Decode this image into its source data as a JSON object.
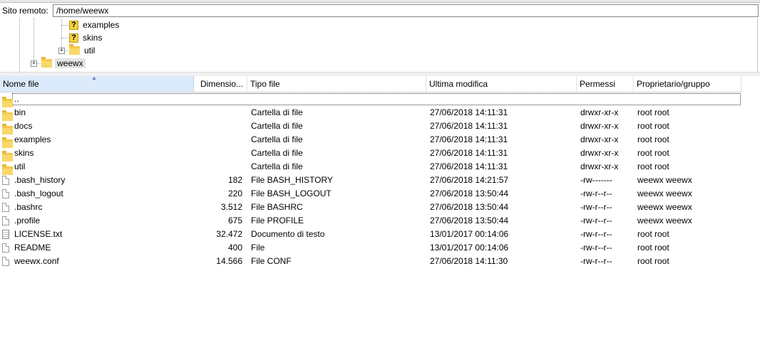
{
  "path_bar": {
    "label": "Sito remoto:",
    "value": "/home/weewx"
  },
  "tree": [
    {
      "label": "examples",
      "icon": "question-folder-icon"
    },
    {
      "label": "skins",
      "icon": "question-folder-icon"
    },
    {
      "label": "util",
      "icon": "folder-icon",
      "expander": "+"
    },
    {
      "label": "weewx",
      "icon": "folder-icon",
      "expander": "+"
    }
  ],
  "columns": [
    "Nome file",
    "Dimensio...",
    "Tipo file",
    "Ultima modifica",
    "Permessi",
    "Proprietario/gruppo"
  ],
  "files": [
    {
      "name": "..",
      "size": "",
      "type": "",
      "modified": "",
      "perms": "",
      "owner": "",
      "icon": "folder-icon"
    },
    {
      "name": "bin",
      "size": "",
      "type": "Cartella di file",
      "modified": "27/06/2018 14:11:31",
      "perms": "drwxr-xr-x",
      "owner": "root root",
      "icon": "folder-icon"
    },
    {
      "name": "docs",
      "size": "",
      "type": "Cartella di file",
      "modified": "27/06/2018 14:11:31",
      "perms": "drwxr-xr-x",
      "owner": "root root",
      "icon": "folder-icon"
    },
    {
      "name": "examples",
      "size": "",
      "type": "Cartella di file",
      "modified": "27/06/2018 14:11:31",
      "perms": "drwxr-xr-x",
      "owner": "root root",
      "icon": "folder-icon"
    },
    {
      "name": "skins",
      "size": "",
      "type": "Cartella di file",
      "modified": "27/06/2018 14:11:31",
      "perms": "drwxr-xr-x",
      "owner": "root root",
      "icon": "folder-icon"
    },
    {
      "name": "util",
      "size": "",
      "type": "Cartella di file",
      "modified": "27/06/2018 14:11:31",
      "perms": "drwxr-xr-x",
      "owner": "root root",
      "icon": "folder-icon"
    },
    {
      "name": ".bash_history",
      "size": "182",
      "type": "File BASH_HISTORY",
      "modified": "27/06/2018 14:21:57",
      "perms": "-rw-------",
      "owner": "weewx weewx",
      "icon": "file-icon"
    },
    {
      "name": ".bash_logout",
      "size": "220",
      "type": "File BASH_LOGOUT",
      "modified": "27/06/2018 13:50:44",
      "perms": "-rw-r--r--",
      "owner": "weewx weewx",
      "icon": "file-icon"
    },
    {
      "name": ".bashrc",
      "size": "3.512",
      "type": "File BASHRC",
      "modified": "27/06/2018 13:50:44",
      "perms": "-rw-r--r--",
      "owner": "weewx weewx",
      "icon": "file-icon"
    },
    {
      "name": ".profile",
      "size": "675",
      "type": "File PROFILE",
      "modified": "27/06/2018 13:50:44",
      "perms": "-rw-r--r--",
      "owner": "weewx weewx",
      "icon": "file-icon"
    },
    {
      "name": "LICENSE.txt",
      "size": "32.472",
      "type": "Documento di testo",
      "modified": "13/01/2017 00:14:06",
      "perms": "-rw-r--r--",
      "owner": "root root",
      "icon": "text-file-icon"
    },
    {
      "name": "README",
      "size": "400",
      "type": "File",
      "modified": "13/01/2017 00:14:06",
      "perms": "-rw-r--r--",
      "owner": "root root",
      "icon": "file-icon"
    },
    {
      "name": "weewx.conf",
      "size": "14.566",
      "type": "File CONF",
      "modified": "27/06/2018 14:11:30",
      "perms": "-rw-r--r--",
      "owner": "root root",
      "icon": "file-icon"
    }
  ]
}
